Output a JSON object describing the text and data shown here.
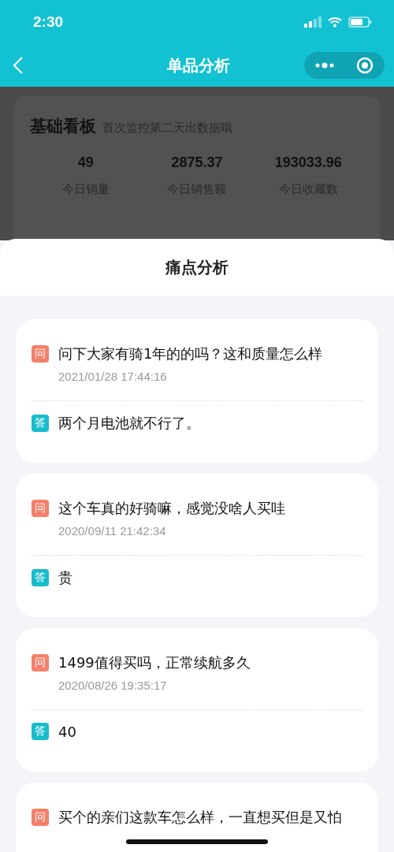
{
  "status_bar": {
    "time": "2:30"
  },
  "nav": {
    "title": "单品分析"
  },
  "board": {
    "title": "基础看板",
    "subtitle": "首次监控第二天出数据哦",
    "stats": [
      {
        "value": "49",
        "label": "今日销量"
      },
      {
        "value": "2875.37",
        "label": "今日销售额"
      },
      {
        "value": "193033.96",
        "label": "今日收藏数"
      }
    ]
  },
  "sheet": {
    "title": "痛点分析",
    "items": [
      {
        "q_mark": "问",
        "question": "问下大家有骑1年的的吗？这和质量怎么样",
        "date": "2021/01/28 17:44:16",
        "a_mark": "答",
        "answer": "两个月电池就不行了。"
      },
      {
        "q_mark": "问",
        "question": "这个车真的好骑嘛，感觉没啥人买哇",
        "date": "2020/09/11 21:42:34",
        "a_mark": "答",
        "answer": "贵"
      },
      {
        "q_mark": "问",
        "question": "1499值得买吗，正常续航多久",
        "date": "2020/08/26 19:35:17",
        "a_mark": "答",
        "answer": "40"
      },
      {
        "q_mark": "问",
        "question": "买个的亲们这款车怎么样，一直想买但是又怕"
      }
    ]
  }
}
